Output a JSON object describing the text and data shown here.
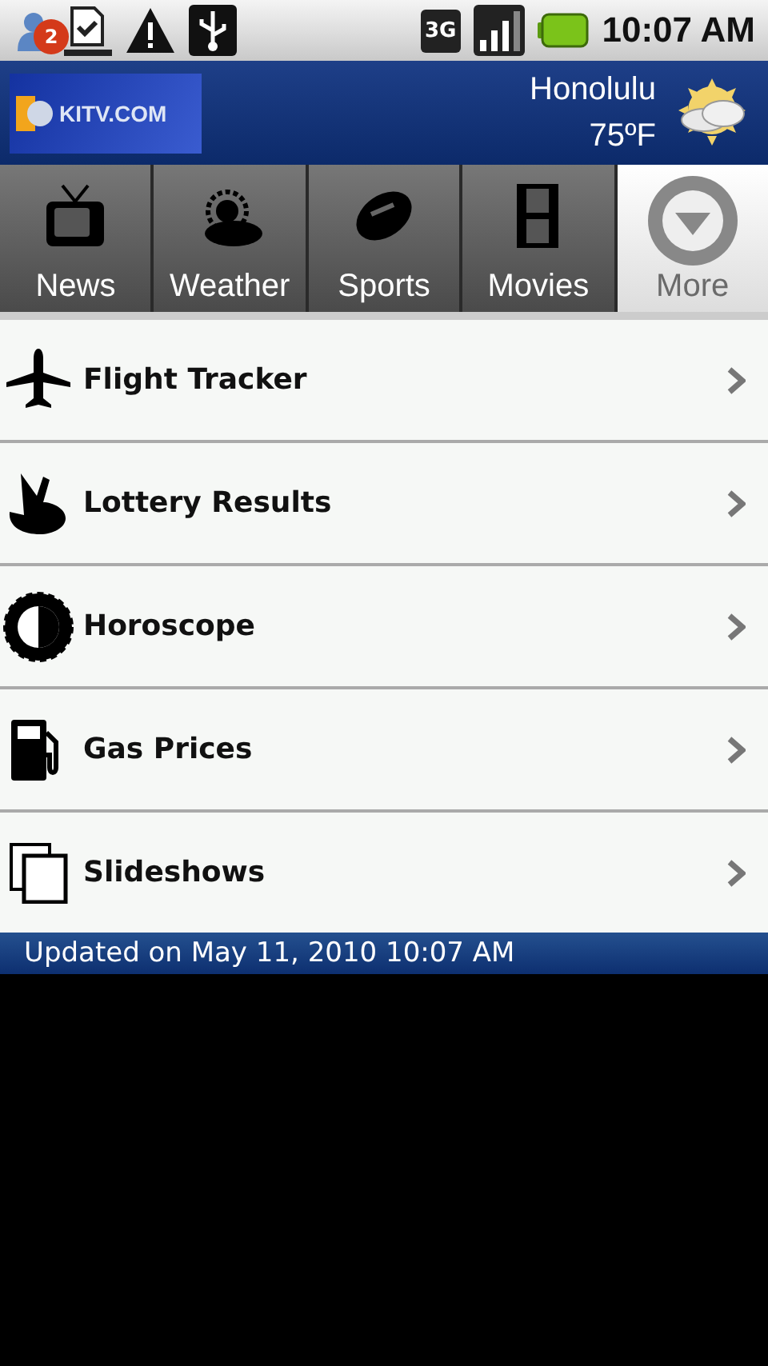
{
  "status_bar": {
    "notification_count": "2",
    "time": "10:07 AM",
    "network": "3G"
  },
  "header": {
    "logo": "KITV.COM",
    "city": "Honolulu",
    "temperature": "75ºF"
  },
  "tabs": [
    {
      "label": "News",
      "selected": false
    },
    {
      "label": "Weather",
      "selected": false
    },
    {
      "label": "Sports",
      "selected": false
    },
    {
      "label": "Movies",
      "selected": false
    },
    {
      "label": "More",
      "selected": true
    }
  ],
  "menu": [
    {
      "label": "Flight Tracker"
    },
    {
      "label": "Lottery Results"
    },
    {
      "label": "Horoscope"
    },
    {
      "label": "Gas Prices"
    },
    {
      "label": "Slideshows"
    }
  ],
  "footer": "Updated on May 11, 2010 10:07 AM"
}
